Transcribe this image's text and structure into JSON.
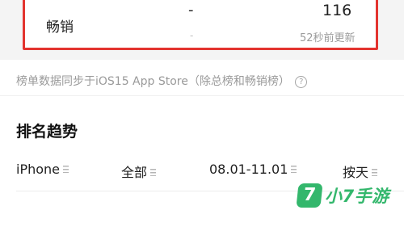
{
  "chart_row": {
    "label": "畅销",
    "value": "-",
    "value_sub": "-",
    "rank": "116",
    "updated": "52秒前更新"
  },
  "sync_note": {
    "text": "榜单数据同步于iOS15 App Store（除总榜和畅销榜）",
    "help_glyph": "?"
  },
  "trend": {
    "title": "排名趋势",
    "filters": [
      {
        "label": "iPhone",
        "icon": "menu-icon"
      },
      {
        "label": "全部",
        "icon": "menu-icon"
      },
      {
        "label": "08.01-11.01",
        "icon": "menu-icon"
      },
      {
        "label": "按天",
        "icon": "menu-icon"
      }
    ]
  },
  "watermark": {
    "logo_glyph": "7",
    "text": "小7手游",
    "color": "#33b76c"
  },
  "colors": {
    "highlight_border": "#e3342f",
    "muted_text": "#9a9a9a"
  }
}
